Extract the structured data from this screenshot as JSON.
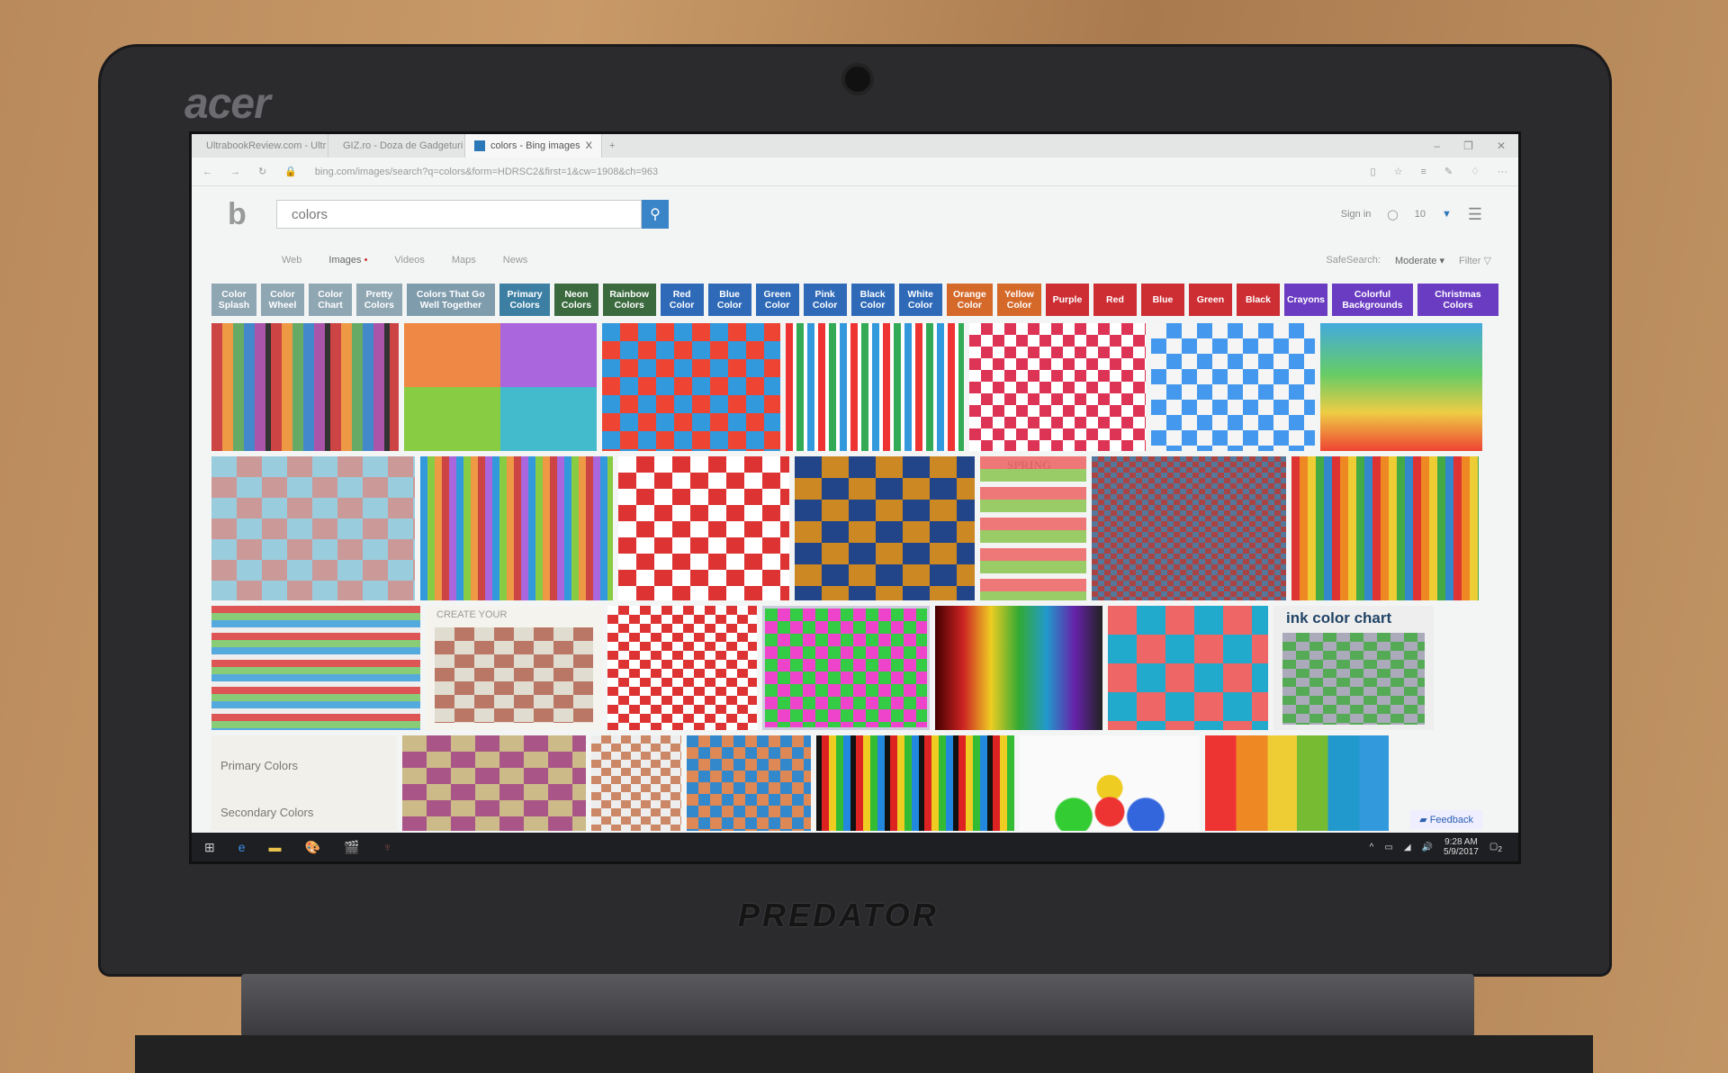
{
  "device": {
    "brand_logo": "acer",
    "model_logo": "PREDATOR"
  },
  "browser": {
    "tabs": [
      {
        "label": "UltrabookReview.com - Ultr"
      },
      {
        "label": "GIZ.ro - Doza de Gadgeturi"
      },
      {
        "label": "colors - Bing images",
        "active": true
      }
    ],
    "new_tab": "+",
    "close_tab": "X",
    "window_controls": [
      "–",
      "❐",
      "✕"
    ],
    "url": "bing.com/images/search?q=colors&form=HDRSC2&first=1&cw=1908&ch=963"
  },
  "bing": {
    "search_value": "colors",
    "sign_in": "Sign in",
    "rewards_count": "10",
    "nav": [
      {
        "label": "Web"
      },
      {
        "label": "Images",
        "active": true
      },
      {
        "label": "Videos"
      },
      {
        "label": "Maps"
      },
      {
        "label": "News"
      }
    ],
    "safesearch_label": "SafeSearch:",
    "safesearch_value": "Moderate ▾",
    "filter": "Filter",
    "chips": [
      {
        "label": "Color Splash",
        "color": "#8fa6b3"
      },
      {
        "label": "Color Wheel",
        "color": "#8fa6b3"
      },
      {
        "label": "Color Chart",
        "color": "#8fa6b3"
      },
      {
        "label": "Pretty Colors",
        "color": "#8fa6b3"
      },
      {
        "label": "Colors That Go Well Together",
        "color": "#7f9cad"
      },
      {
        "label": "Primary Colors",
        "color": "#3c7fa3"
      },
      {
        "label": "Neon Colors",
        "color": "#3b6a3e"
      },
      {
        "label": "Rainbow Colors",
        "color": "#3b6a3e"
      },
      {
        "label": "Red Color",
        "color": "#2f6ab8"
      },
      {
        "label": "Blue Color",
        "color": "#2f6ab8"
      },
      {
        "label": "Green Color",
        "color": "#2f6ab8"
      },
      {
        "label": "Pink Color",
        "color": "#2f6ab8"
      },
      {
        "label": "Black Color",
        "color": "#2f6ab8"
      },
      {
        "label": "White Color",
        "color": "#2f6ab8"
      },
      {
        "label": "Orange Color",
        "color": "#d4692a"
      },
      {
        "label": "Yellow Color",
        "color": "#d4692a"
      },
      {
        "label": "Purple",
        "color": "#cc2e34"
      },
      {
        "label": "Red",
        "color": "#cc2e34"
      },
      {
        "label": "Blue",
        "color": "#cc2e34"
      },
      {
        "label": "Green",
        "color": "#cc2e34"
      },
      {
        "label": "Black",
        "color": "#cc2e34"
      },
      {
        "label": "Crayons",
        "color": "#6a3cc2"
      },
      {
        "label": "Colorful Backgrounds",
        "color": "#6a3cc2"
      },
      {
        "label": "Christmas Colors",
        "color": "#6a3cc2"
      }
    ],
    "image_texts": {
      "spring": "SPRING",
      "create": "CREATE YOUR",
      "ink": "ink color chart",
      "primary": "Primary Colors",
      "secondary": "Secondary Colors"
    },
    "feedback": "Feedback"
  },
  "taskbar": {
    "time": "9:28 AM",
    "date": "5/9/2017",
    "notifications": "2"
  }
}
